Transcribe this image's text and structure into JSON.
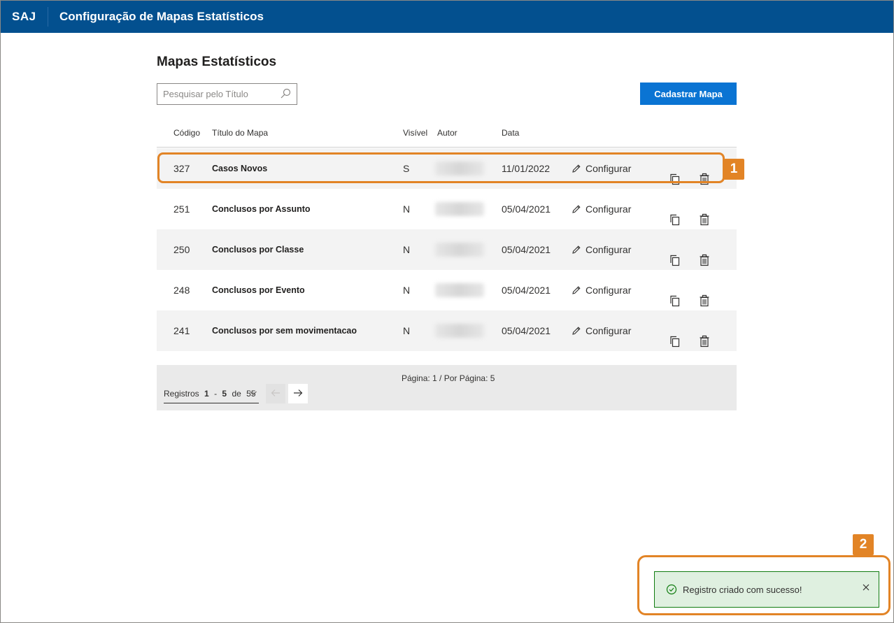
{
  "header": {
    "brand": "SAJ",
    "title": "Configuração de Mapas Estatísticos"
  },
  "main": {
    "page_title": "Mapas Estatísticos",
    "search": {
      "placeholder": "Pesquisar pelo Título",
      "value": ""
    },
    "add_button": "Cadastrar Mapa"
  },
  "table": {
    "columns": [
      "Código",
      "Título do Mapa",
      "Visível",
      "Autor",
      "Data"
    ],
    "rows": [
      {
        "code": "327",
        "title": "Casos Novos",
        "visible": "S",
        "date": "11/01/2022",
        "config": "Configurar"
      },
      {
        "code": "251",
        "title": "Conclusos por Assunto",
        "visible": "N",
        "date": "05/04/2021",
        "config": "Configurar"
      },
      {
        "code": "250",
        "title": "Conclusos por Classe",
        "visible": "N",
        "date": "05/04/2021",
        "config": "Configurar"
      },
      {
        "code": "248",
        "title": "Conclusos por Evento",
        "visible": "N",
        "date": "05/04/2021",
        "config": "Configurar"
      },
      {
        "code": "241",
        "title": "Conclusos por sem movimentacao",
        "visible": "N",
        "date": "05/04/2021",
        "config": "Configurar"
      }
    ]
  },
  "pagination": {
    "page_info": "Página: 1 / Por Página: 5",
    "records_prefix": "Registros",
    "range_start": "1",
    "range_sep": "-",
    "range_end": "5",
    "of_label": "de",
    "total": "55"
  },
  "annotations": {
    "badge1": "1",
    "badge2": "2"
  },
  "toast": {
    "message": "Registro criado com sucesso!"
  },
  "colors": {
    "header_bg": "#03508f",
    "primary": "#0a74d3",
    "highlight": "#e28426",
    "toast_bg": "#dff0e0",
    "toast_border": "#107c10"
  }
}
